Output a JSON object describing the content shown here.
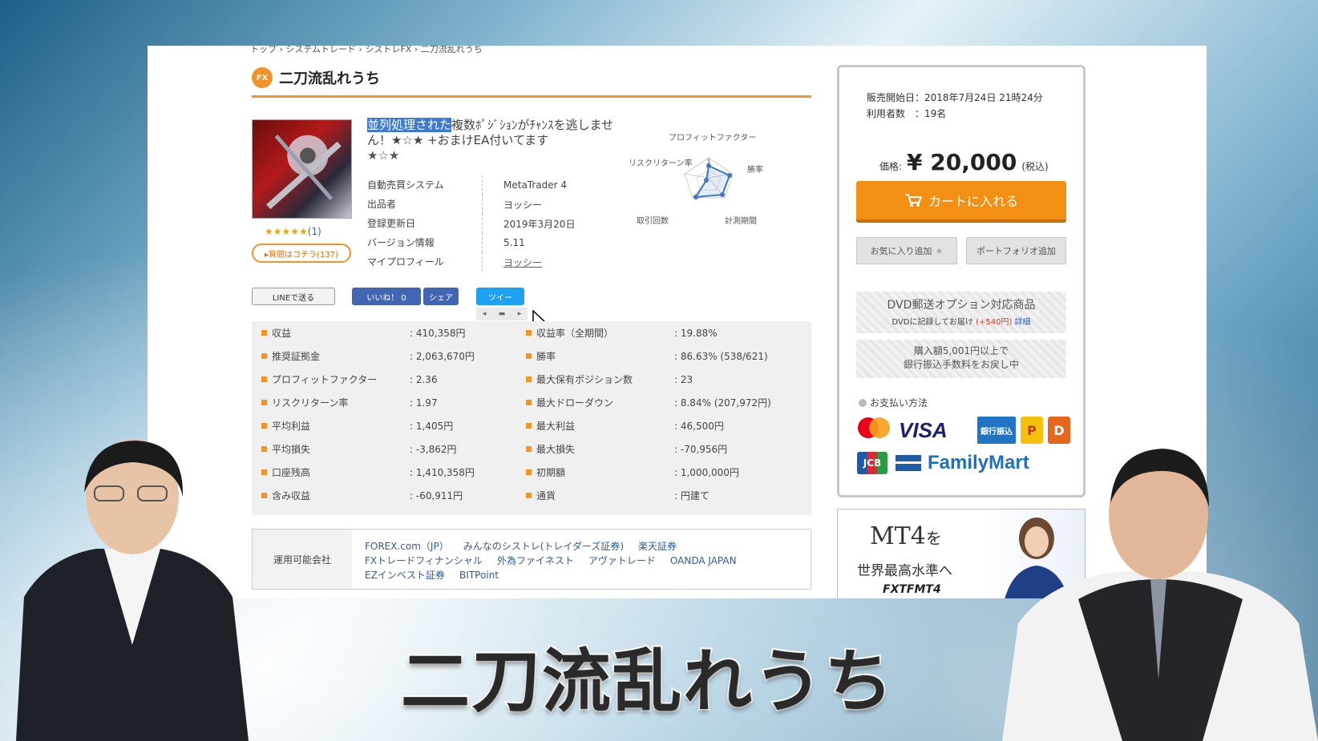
{
  "breadcrumb": "トップ › システムトレード › シストレFX › 二刀流乱れうち",
  "product": {
    "badge": "FX",
    "title": "二刀流乱れうち",
    "stars": "★★★★★",
    "review_count": "(1)",
    "question_button": "▸質問はコチラ(137)",
    "desc_highlight": "並列処理された",
    "desc_rest": "複数ﾎﾟｼﾞｼｮﾝがﾁｬﾝｽを逃しません！★☆★ +おまけEA付いてます",
    "desc_stars": "★☆★"
  },
  "info": [
    {
      "key": "自動売買システム",
      "value": "MetaTrader 4"
    },
    {
      "key": "出品者",
      "value": "ヨッシー"
    },
    {
      "key": "登録更新日",
      "value": "2019年3月20日"
    },
    {
      "key": "バージョン情報",
      "value": "5.11"
    },
    {
      "key": "マイプロフィール",
      "value": "ヨッシー"
    }
  ],
  "radar": {
    "top": "プロフィットファクター",
    "left": "リスクリターン率",
    "right": "勝率",
    "bottom_left": "取引回数",
    "bottom_right": "計測期間",
    "scale_mark": "3"
  },
  "social": {
    "line": "LINEで送る",
    "like": "いいね！ 0",
    "share": "シェア",
    "tweet": "ツイー"
  },
  "stats_left": [
    {
      "key": "収益",
      "value": ": 410,358円"
    },
    {
      "key": "推奨証拠金",
      "value": ": 2,063,670円"
    },
    {
      "key": "プロフィットファクター",
      "value": ": 2.36"
    },
    {
      "key": "リスクリターン率",
      "value": ": 1.97"
    },
    {
      "key": "平均利益",
      "value": ": 1,405円"
    },
    {
      "key": "平均損失",
      "value": ": -3,862円"
    },
    {
      "key": "口座残高",
      "value": ": 1,410,358円"
    },
    {
      "key": "含み収益",
      "value": ": -60,911円"
    }
  ],
  "stats_right": [
    {
      "key": "収益率（全期間）",
      "value": ": 19.88%"
    },
    {
      "key": "勝率",
      "value": ": 86.63% (538/621)"
    },
    {
      "key": "最大保有ポジション数",
      "value": ": 23"
    },
    {
      "key": "最大ドローダウン",
      "value": ": 8.84% (207,972円)"
    },
    {
      "key": "最大利益",
      "value": ": 46,500円"
    },
    {
      "key": "最大損失",
      "value": ": -70,956円"
    },
    {
      "key": "初期額",
      "value": ": 1,000,000円"
    },
    {
      "key": "通貨",
      "value": ": 円建て"
    }
  ],
  "operators": {
    "label": "運用可能会社",
    "companies": [
      "FOREX.com（JP）",
      "みんなのシストレ(トレイダーズ証券)",
      "楽天証券",
      "FXトレードフィナンシャル",
      "外為ファイネスト",
      "アヴァトレード",
      "OANDA JAPAN",
      "EZインベスト証券",
      "BITPoint"
    ]
  },
  "sidebar": {
    "release": "販売開始日：2018年7月24日 21時24分",
    "users": "利用者数　：19名",
    "price_label": "価格:",
    "price": "¥ 20,000",
    "tax": "(税込)",
    "cart": "カートに入れる",
    "favorite": "お気に入り追加",
    "portfolio": "ポートフォリオ追加",
    "dvd_title": "DVD郵送オプション対応商品",
    "dvd_sub_a": "DVDに記録してお届け",
    "dvd_sub_price": "(+540円)",
    "dvd_sub_detail": "詳細",
    "bank_line1": "購入額5,001円以上で",
    "bank_line2": "銀行振込手数料をお戻し中",
    "payment_heading": "お支払い方法",
    "logos": {
      "visa": "VISA",
      "bank": "銀行振込",
      "jcb": "JCB",
      "familymart": "FamilyMart",
      "pay1": "P",
      "pay2": "D"
    }
  },
  "ad": {
    "mt4": "MT4",
    "mt4_suffix": "を",
    "sub": "世界最高水準へ",
    "brand": "FXTFMT4"
  },
  "caption": "二刀流乱れうち",
  "colors": {
    "accent": "#f29329",
    "link": "#3a5ea8",
    "cart": "#f39013"
  }
}
